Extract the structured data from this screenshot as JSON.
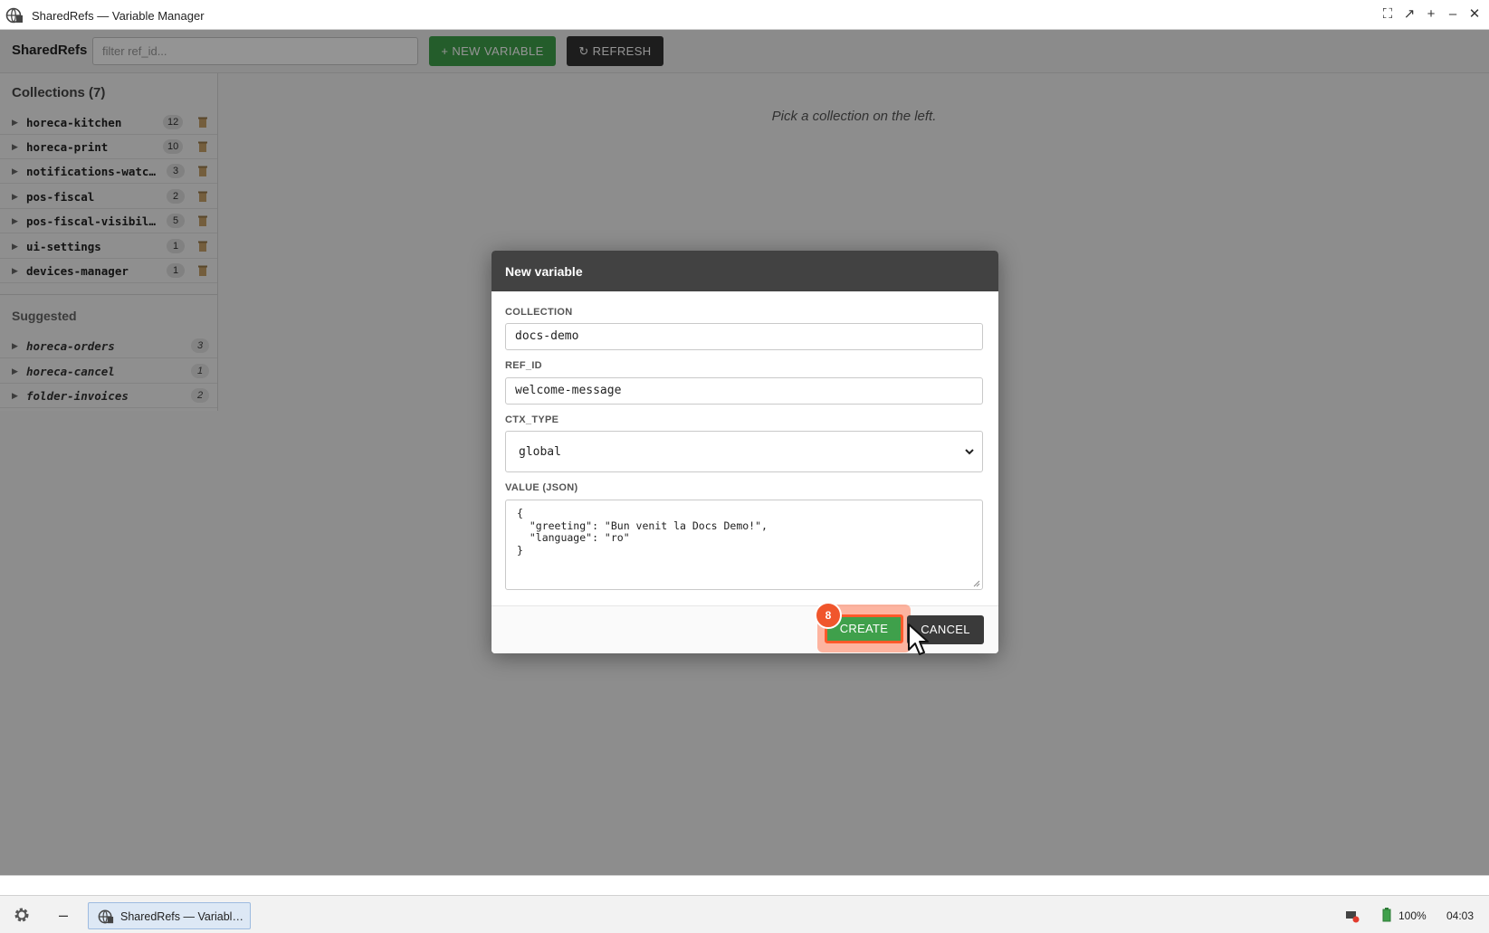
{
  "window": {
    "title": "SharedRefs — Variable Manager"
  },
  "toolbar": {
    "brand": "SharedRefs",
    "filter_placeholder": "filter ref_id...",
    "new_variable_label": "+ NEW VARIABLE",
    "refresh_label": "↻ REFRESH"
  },
  "sidebar": {
    "collections_heading": "Collections (7)",
    "collections": [
      {
        "name": "horeca-kitchen",
        "count": "12"
      },
      {
        "name": "horeca-print",
        "count": "10"
      },
      {
        "name": "notifications-watch…",
        "count": "3"
      },
      {
        "name": "pos-fiscal",
        "count": "2"
      },
      {
        "name": "pos-fiscal-visibili…",
        "count": "5"
      },
      {
        "name": "ui-settings",
        "count": "1"
      },
      {
        "name": "devices-manager",
        "count": "1"
      }
    ],
    "suggested_heading": "Suggested",
    "suggested": [
      {
        "name": "horeca-orders",
        "count": "3"
      },
      {
        "name": "horeca-cancel",
        "count": "1"
      },
      {
        "name": "folder-invoices",
        "count": "2"
      }
    ]
  },
  "main": {
    "placeholder": "Pick a collection on the left."
  },
  "dialog": {
    "title": "New variable",
    "collection_label": "COLLECTION",
    "collection_value": "docs-demo",
    "ref_id_label": "REF_ID",
    "ref_id_value": "welcome-message",
    "ctx_type_label": "CTX_TYPE",
    "ctx_type_value": "global",
    "value_label": "VALUE (JSON)",
    "value_json": "{\n  \"greeting\": \"Bun venit la Docs Demo!\",\n  \"language\": \"ro\"\n}",
    "create_label": "CREATE",
    "cancel_label": "CANCEL",
    "step_number": "8"
  },
  "taskbar": {
    "task_label": "SharedRefs — Variabl…",
    "battery": "100%",
    "clock": "04:03"
  },
  "colors": {
    "primary_green": "#3fa04b",
    "dark": "#333333",
    "highlight": "#ff5a2a"
  }
}
